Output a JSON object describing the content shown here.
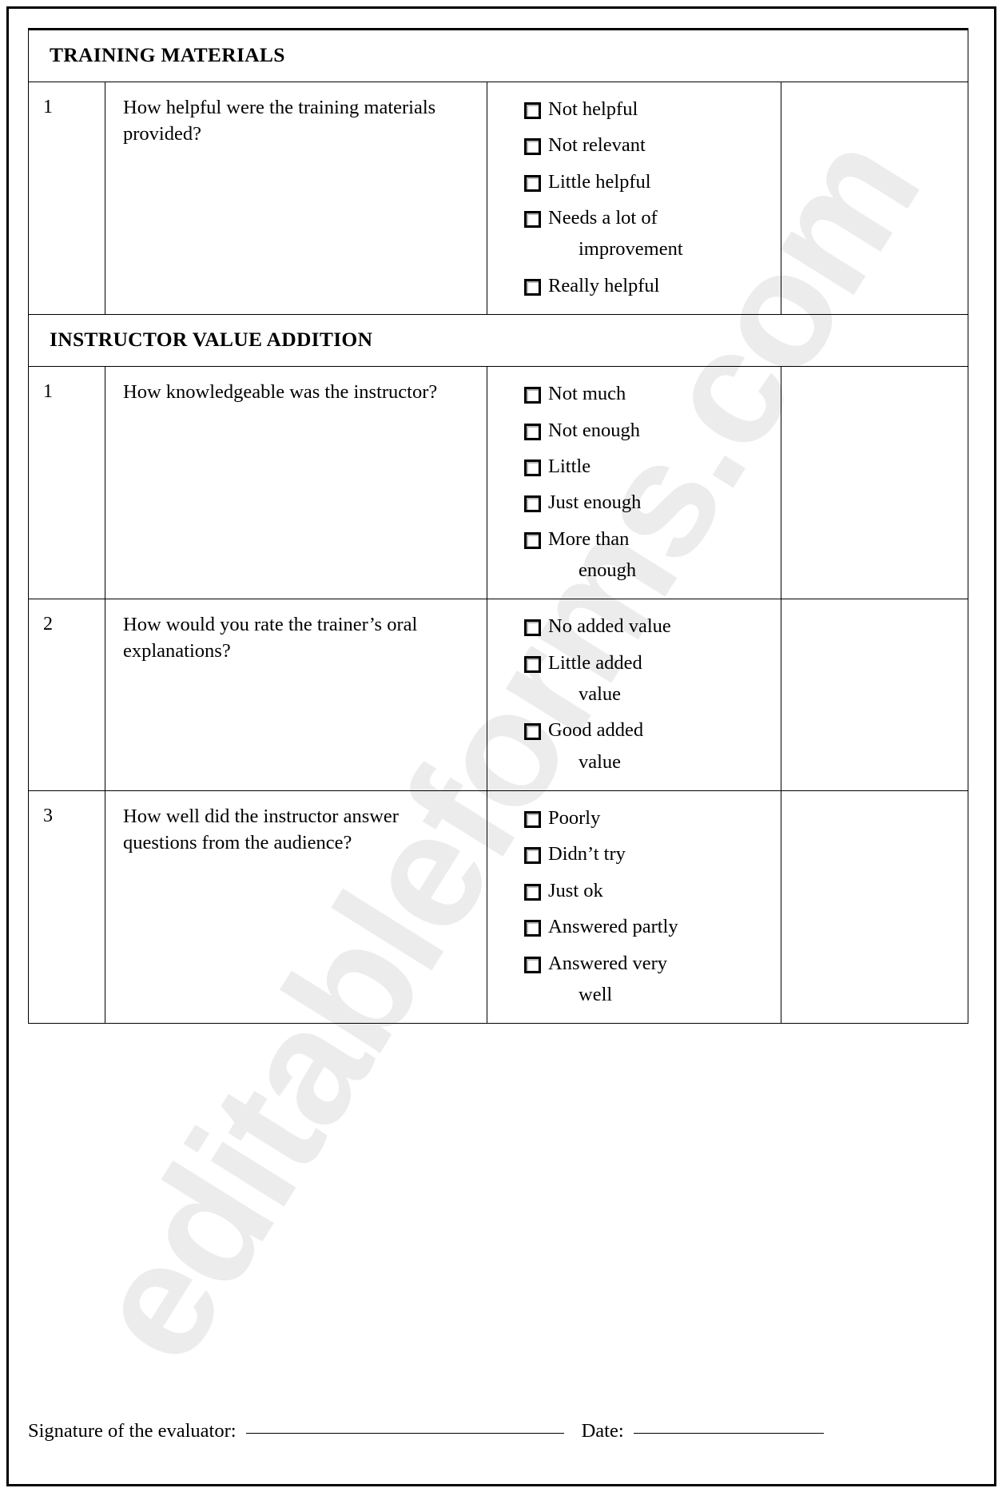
{
  "watermark": "editableforms.com",
  "sections": [
    {
      "title": "TRAINING MATERIALS",
      "questions": [
        {
          "number": "1",
          "text": "How helpful were the training materials provided?",
          "options": [
            "Not helpful",
            "Not relevant",
            "Little helpful",
            "Needs a lot of\nimprovement",
            "Really helpful"
          ]
        }
      ]
    },
    {
      "title": "INSTRUCTOR VALUE ADDITION",
      "questions": [
        {
          "number": "1",
          "text": "How knowledgeable was the instructor?",
          "options": [
            "Not much",
            "Not enough",
            "Little",
            "Just enough",
            "More than\nenough"
          ]
        },
        {
          "number": "2",
          "text": "How would you rate the trainer’s oral explanations?",
          "options": [
            "No added value",
            "Little added\nvalue",
            "Good added\nvalue"
          ]
        },
        {
          "number": "3",
          "text": "How well did the instructor answer questions from the audience?",
          "options": [
            "Poorly",
            "Didn’t try",
            "Just ok",
            "Answered partly",
            "Answered very\nwell"
          ]
        }
      ]
    }
  ],
  "footer": {
    "signature_label": "Signature of the evaluator:",
    "date_label": "Date:"
  }
}
